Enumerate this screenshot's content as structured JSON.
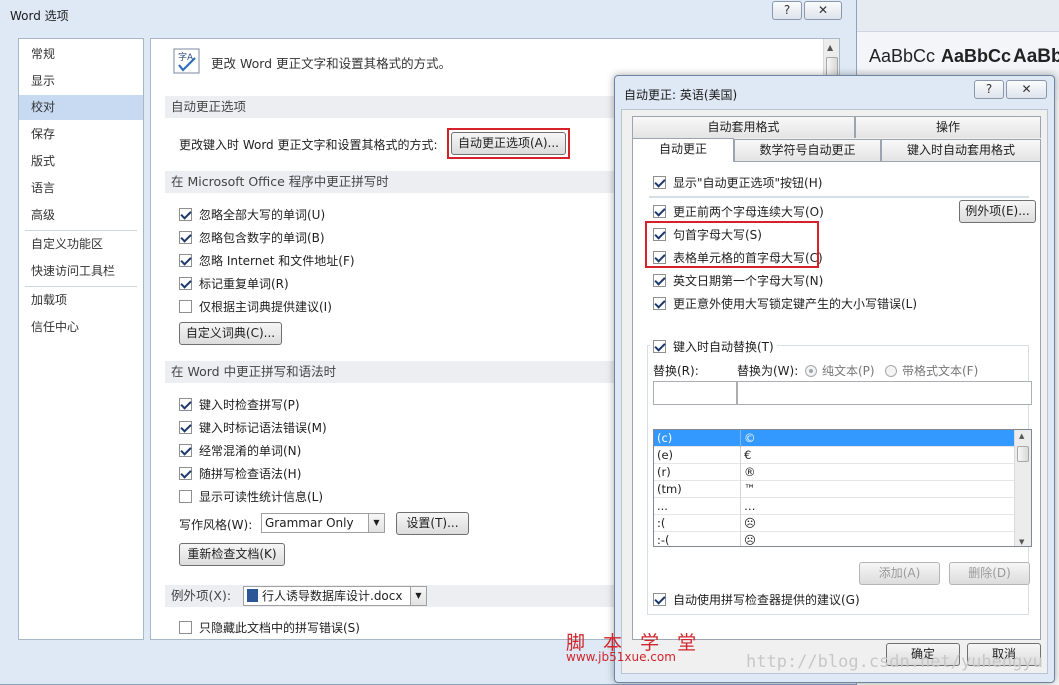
{
  "background": {
    "styles": [
      "AaBbCc",
      "AaBbCc",
      "AaBbC"
    ]
  },
  "options_window": {
    "title": "Word 选项",
    "help_btn": "?",
    "close_btn": "✕",
    "nav": [
      "常规",
      "显示",
      "校对",
      "保存",
      "版式",
      "语言",
      "高级",
      "自定义功能区",
      "快速访问工具栏",
      "加载项",
      "信任中心"
    ],
    "header_text": "更改 Word 更正文字和设置其格式的方式。",
    "autocorrect_section": {
      "title": "自动更正选项",
      "label": "更改键入时 Word 更正文字和设置其格式的方式:",
      "button": "自动更正选项(A)..."
    },
    "office_spelling_section": {
      "title": "在 Microsoft Office 程序中更正拼写时",
      "options": [
        {
          "label": "忽略全部大写的单词(U)",
          "checked": true
        },
        {
          "label": "忽略包含数字的单词(B)",
          "checked": true
        },
        {
          "label": "忽略 Internet 和文件地址(F)",
          "checked": true
        },
        {
          "label": "标记重复单词(R)",
          "checked": true
        },
        {
          "label": "仅根据主词典提供建议(I)",
          "checked": false
        }
      ],
      "custom_dict_button": "自定义词典(C)..."
    },
    "word_spelling_section": {
      "title": "在 Word 中更正拼写和语法时",
      "options": [
        {
          "label": "键入时检查拼写(P)",
          "checked": true
        },
        {
          "label": "键入时标记语法错误(M)",
          "checked": true
        },
        {
          "label": "经常混淆的单词(N)",
          "checked": true
        },
        {
          "label": "随拼写检查语法(H)",
          "checked": true
        },
        {
          "label": "显示可读性统计信息(L)",
          "checked": false
        }
      ],
      "writing_style_label": "写作风格(W):",
      "writing_style_value": "Grammar Only",
      "settings_button": "设置(T)...",
      "recheck_button": "重新检查文档(K)"
    },
    "exceptions": {
      "label": "例外项(X):",
      "file": "行人诱导数据库设计.docx",
      "hide_option": {
        "label": "只隐藏此文档中的拼写错误(S)",
        "checked": false
      }
    }
  },
  "autocorrect_dialog": {
    "title": "自动更正: 英语(美国)",
    "help_btn": "?",
    "close_btn": "✕",
    "tabs_row1": [
      "自动套用格式",
      "操作"
    ],
    "tabs_row2": [
      "自动更正",
      "数学符号自动更正",
      "键入时自动套用格式"
    ],
    "active_tab": "自动更正",
    "show_button_option": {
      "label": "显示\"自动更正选项\"按钮(H)",
      "checked": true
    },
    "options": [
      {
        "label": "更正前两个字母连续大写(O)",
        "checked": true
      },
      {
        "label": "句首字母大写(S)",
        "checked": true
      },
      {
        "label": "表格单元格的首字母大写(C)",
        "checked": true
      },
      {
        "label": "英文日期第一个字母大写(N)",
        "checked": true
      },
      {
        "label": "更正意外使用大写锁定键产生的大小写错误(L)",
        "checked": true
      }
    ],
    "exceptions_button": "例外项(E)...",
    "replace_group": {
      "title": "键入时自动替换(T)",
      "checked": true,
      "replace_label": "替换(R):",
      "with_label": "替换为(W):",
      "plain_text": "纯文本(P)",
      "formatted_text": "带格式文本(F)",
      "entries": [
        {
          "from": "(c)",
          "to": "©"
        },
        {
          "from": "(e)",
          "to": "€"
        },
        {
          "from": "(r)",
          "to": "®"
        },
        {
          "from": "(tm)",
          "to": "™"
        },
        {
          "from": "...",
          "to": "…"
        },
        {
          "from": ":(",
          "to": "☹"
        },
        {
          "from": ":-(",
          "to": "☹"
        }
      ],
      "add_button": "添加(A)",
      "delete_button": "删除(D)"
    },
    "auto_suggest_option": {
      "label": "自动使用拼写检查器提供的建议(G)",
      "checked": true
    },
    "ok_button": "确定",
    "cancel_button": "取消"
  },
  "watermark": {
    "site_cn": "脚 本 学 堂",
    "site_url": "www.jb51xue.com",
    "blog_url": "http://blog.csdn.net/yuhengyu"
  },
  "colors": {
    "highlight": "#d6202a",
    "selection": "#3399ff",
    "nav_selected": "#c7daf2"
  }
}
